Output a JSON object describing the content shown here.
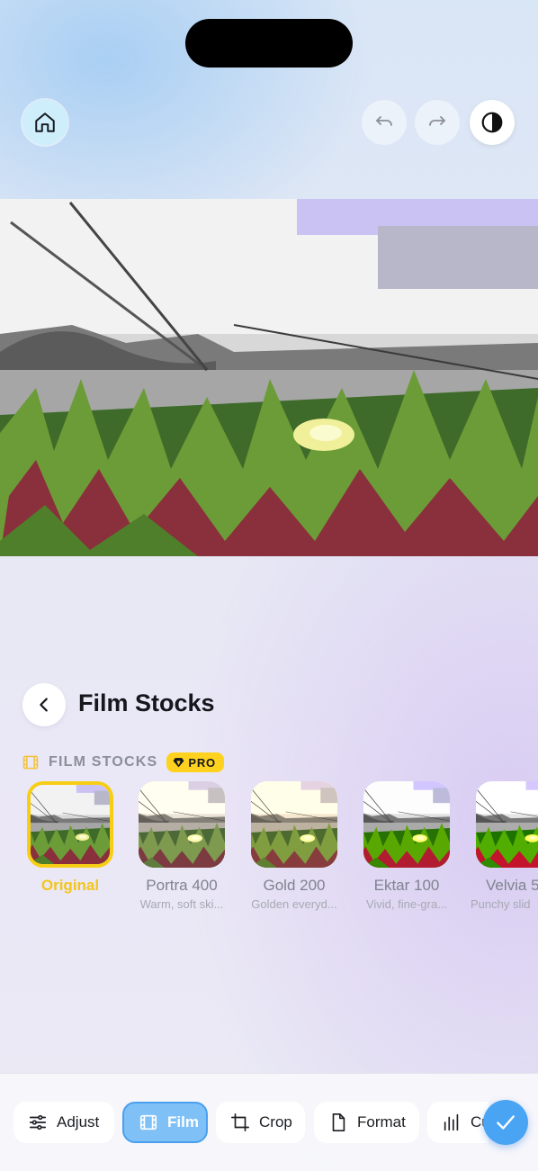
{
  "header": {
    "home_icon": "house-icon",
    "undo_icon": "undo-arrow-icon",
    "redo_icon": "redo-arrow-icon",
    "compare_icon": "contrast-half-circle-icon"
  },
  "panel": {
    "back_icon": "chevron-left-icon",
    "title": "Film Stocks",
    "section_label": "FILM STOCKS",
    "section_icon": "film-icon",
    "pro_badge": "PRO",
    "pro_icon": "diamond-icon"
  },
  "film_stocks": [
    {
      "name": "Original",
      "description": "",
      "selected": true
    },
    {
      "name": "Portra 400",
      "description": "Warm, soft ski...",
      "selected": false
    },
    {
      "name": "Gold 200",
      "description": "Golden everyd...",
      "selected": false
    },
    {
      "name": "Ektar 100",
      "description": "Vivid, fine-gra...",
      "selected": false
    },
    {
      "name": "Velvia 5",
      "description": "Punchy slid",
      "selected": false
    }
  ],
  "toolbar": {
    "tools": [
      {
        "label": "Adjust",
        "icon": "sliders-icon",
        "active": false
      },
      {
        "label": "Film",
        "icon": "film-icon",
        "active": true
      },
      {
        "label": "Crop",
        "icon": "crop-icon",
        "active": false
      },
      {
        "label": "Format",
        "icon": "document-icon",
        "active": false
      },
      {
        "label": "Cu",
        "icon": "bar-chart-icon",
        "active": false
      }
    ],
    "done_icon": "checkmark-icon"
  },
  "colors": {
    "accent_blue": "#4aa4f4",
    "selected_yellow": "#f7ce16",
    "pro_yellow": "#ffd21f"
  }
}
